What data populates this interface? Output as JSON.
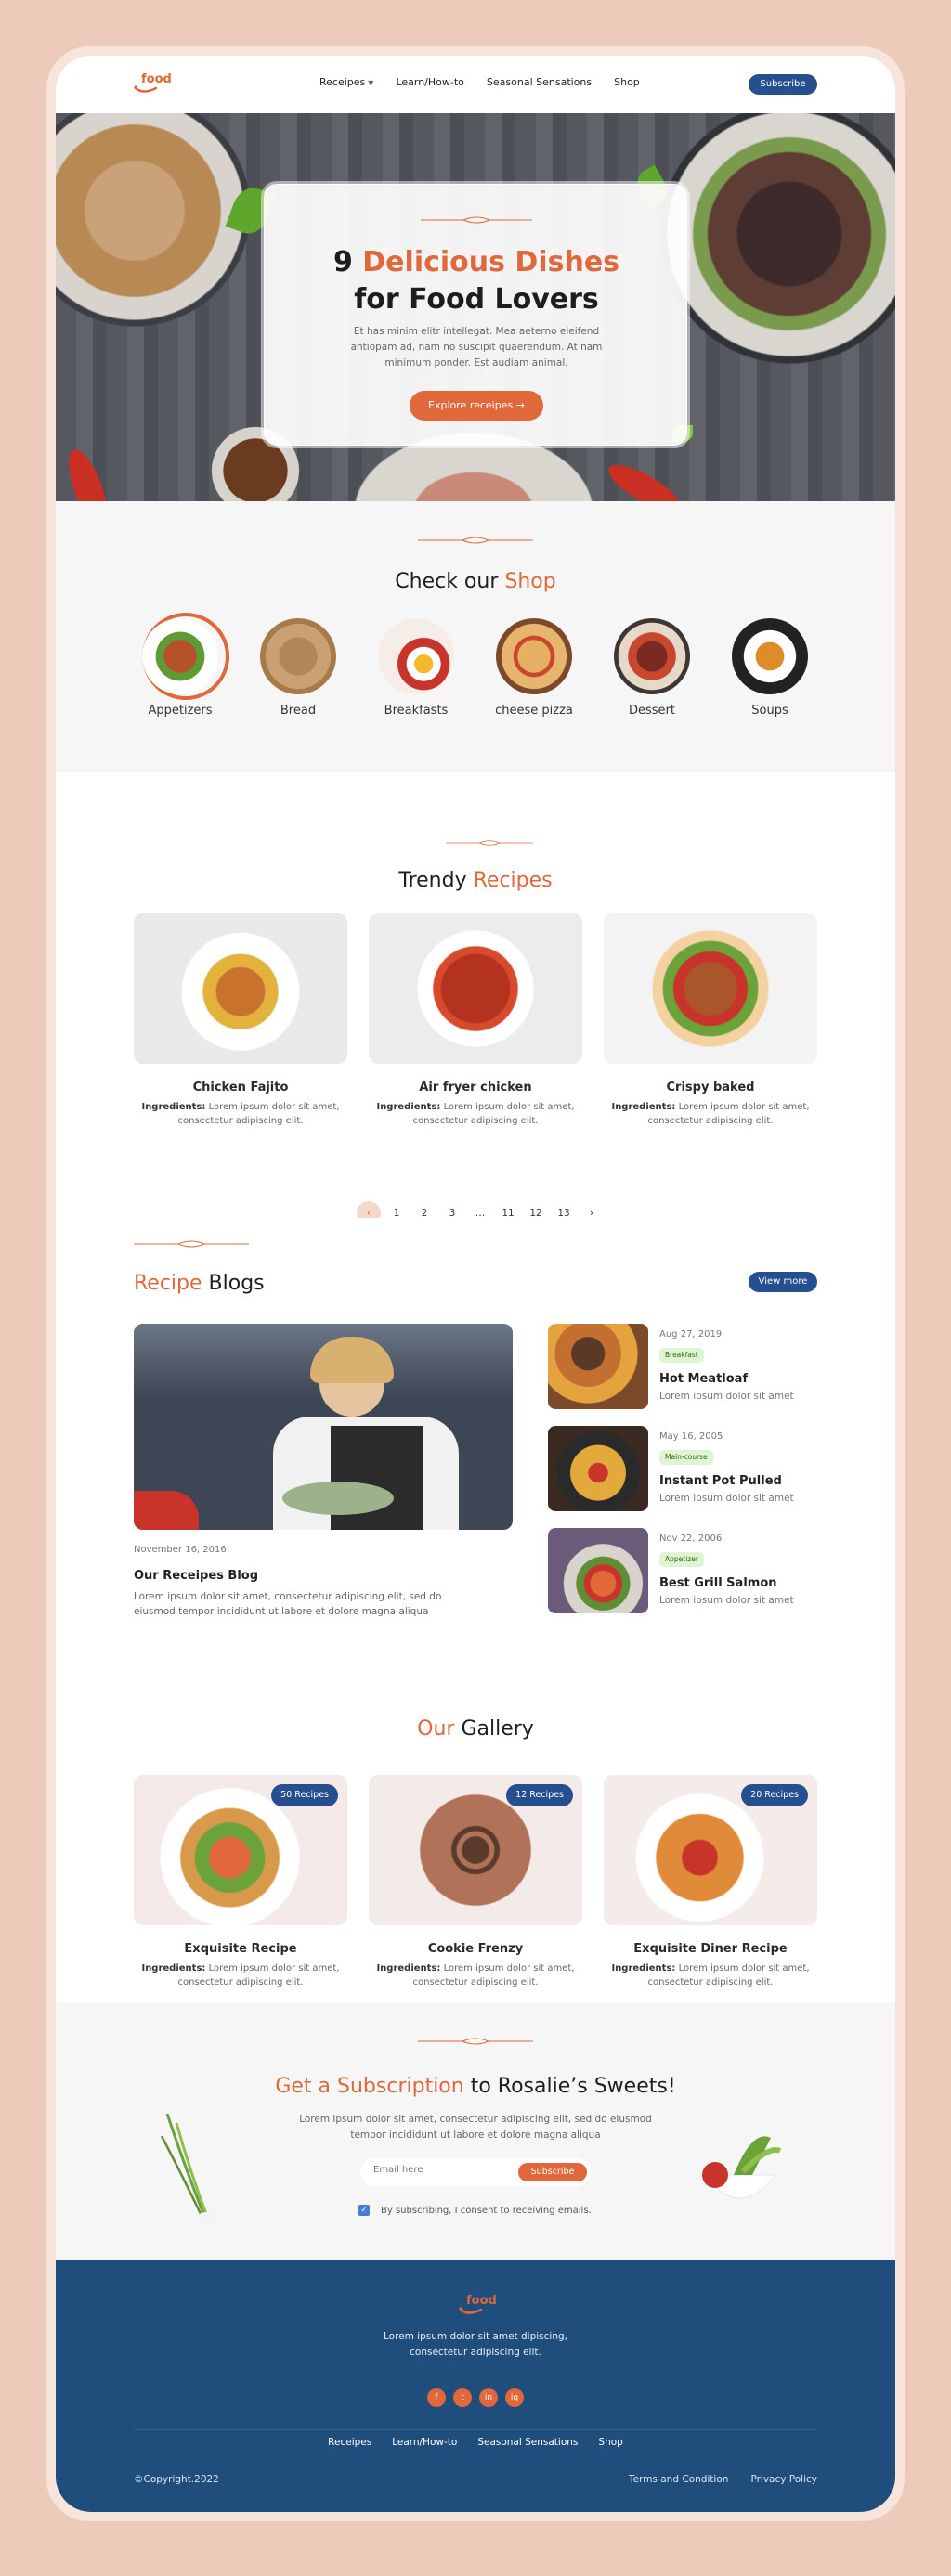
{
  "brand": {
    "logo_text": "food"
  },
  "header": {
    "nav": [
      "Receipes",
      "Learn/How-to",
      "Seasonal Sensations",
      "Shop"
    ],
    "subscribe_label": "Subscribe"
  },
  "hero": {
    "title_number": "9",
    "title_accent": "Delicious Dishes",
    "title_line2": "for Food Lovers",
    "text": "Et has minim elitr intellegat. Mea aeterno eleifend antiopam ad, nam no suscipit quaerendum. At nam minimum ponder. Est audiam animal.",
    "button": "Explore receipes →"
  },
  "shop": {
    "title_prefix": "Check our",
    "title_accent": "Shop",
    "categories": [
      "Appetizers",
      "Bread",
      "Breakfasts",
      "cheese pizza",
      "Dessert",
      "Soups"
    ]
  },
  "trendy": {
    "title_prefix": "Trendy",
    "title_accent": "Recipes",
    "cards": [
      {
        "title": "Chicken Fajito",
        "ingr_label": "Ingredients:",
        "ingr": "Lorem ipsum dolor sit amet, consectetur adipiscing elit."
      },
      {
        "title": "Air fryer chicken",
        "ingr_label": "Ingredients:",
        "ingr": "Lorem ipsum dolor sit amet, consectetur adipiscing elit."
      },
      {
        "title": "Crispy baked",
        "ingr_label": "Ingredients:",
        "ingr": "Lorem ipsum dolor sit amet, consectetur adipiscing elit."
      }
    ],
    "pagination": [
      "‹",
      "1",
      "2",
      "3",
      "…",
      "11",
      "12",
      "13",
      "›"
    ]
  },
  "blogs": {
    "title_accent": "Recipe",
    "title_suffix": "Blogs",
    "view_more": "View more",
    "main": {
      "date": "November 16, 2016",
      "title": "Our Receipes Blog",
      "text": "Lorem ipsum dolor sit amet, consectetur adipiscing elit, sed do eiusmod tempor incididunt ut labore et dolore magna aliqua"
    },
    "side": [
      {
        "date": "Aug 27, 2019",
        "badge": "Breakfast",
        "title": "Hot Meatloaf",
        "desc": "Lorem ipsum dolor sit amet"
      },
      {
        "date": "May 16, 2005",
        "badge": "Main-course",
        "title": "Instant Pot Pulled",
        "desc": "Lorem ipsum dolor sit amet"
      },
      {
        "date": "Nov 22, 2006",
        "badge": "Appetizer",
        "title": "Best Grill Salmon",
        "desc": "Lorem ipsum dolor sit amet"
      }
    ]
  },
  "gallery": {
    "title_accent": "Our",
    "title_suffix": "Gallery",
    "cards": [
      {
        "pill": "50 Recipes",
        "title": "Exquisite  Recipe",
        "ingr_label": "Ingredients:",
        "ingr": "Lorem ipsum dolor sit amet, consectetur adipiscing elit."
      },
      {
        "pill": "12 Recipes",
        "title": "Cookie Frenzy",
        "ingr_label": "Ingredients:",
        "ingr": "Lorem ipsum dolor sit amet, consectetur adipiscing elit."
      },
      {
        "pill": "20 Recipes",
        "title": "Exquisite Diner Recipe",
        "ingr_label": "Ingredients:",
        "ingr": "Lorem ipsum dolor sit amet, consectetur adipiscing elit."
      }
    ]
  },
  "subscription": {
    "title_accent": "Get a Subscription",
    "title_suffix": "to Rosalie’s Sweets!",
    "text": "Lorem ipsum dolor sit amet, consectetur adipiscing elit, sed do eiusmod tempor incididunt ut labore et dolore magna aliqua",
    "email_placeholder": "Email here",
    "button": "Subscribe",
    "consent": "By subscribing, I consent to receiving emails."
  },
  "footer": {
    "logo_text": "food",
    "text": "Lorem ipsum dolor sit amet dipiscing, consectetur adipiscing elit.",
    "socials": [
      "f",
      "t",
      "in",
      "ig"
    ],
    "nav": [
      "Receipes",
      "Learn/How-to",
      "Seasonal Sensations",
      "Shop"
    ],
    "copyright": "©Copyright.2022",
    "legal": [
      "Terms and Condition",
      "Privacy Policy"
    ]
  },
  "colors": {
    "accent": "#e0683a",
    "navy": "#264f8f",
    "footer": "#1f4d7c",
    "page_bg": "#eccbbb"
  }
}
